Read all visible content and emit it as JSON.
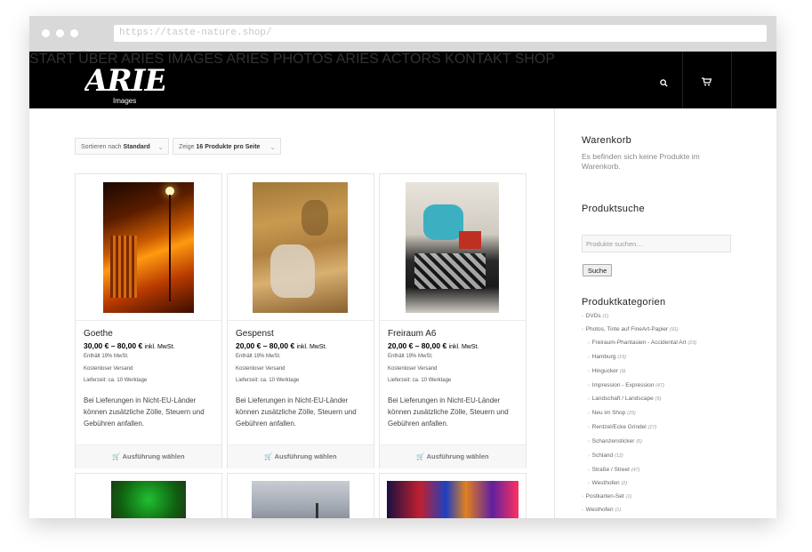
{
  "browser": {
    "url": "https://taste-nature.shop/"
  },
  "header": {
    "logo_text": "ARIES",
    "logo_sub": "Images",
    "nav": [
      "START",
      "ÜBER ARIES IMAGES",
      "ARIES PHOTOS",
      "ARIES ACTORS",
      "KONTAKT",
      "SHOP"
    ]
  },
  "shop": {
    "sort_prefix": "Sortieren nach",
    "sort_value": "Standard",
    "perpage_prefix": "Zeige",
    "perpage_value": "16 Produkte pro Seite",
    "products": [
      {
        "title": "Goethe",
        "price": "30,00 € – 80,00 €",
        "tax_suffix": "inkl. MwSt.",
        "vat": "Enthält 19% MwSt.",
        "shipping": "Kostenloser Versand",
        "delivery": "Lieferzeit: ca. 10 Werktage",
        "desc": "Bei Lieferungen in Nicht-EU-Länder können zusätzliche Zölle, Steuern und Gebühren anfallen.",
        "button": "Ausführung wählen"
      },
      {
        "title": "Gespenst",
        "price": "20,00 € – 80,00 €",
        "tax_suffix": "inkl. MwSt.",
        "vat": "Enthält 19% MwSt.",
        "shipping": "Kostenloser Versand",
        "delivery": "Lieferzeit: ca. 10 Werktage",
        "desc": "Bei Lieferungen in Nicht-EU-Länder können zusätzliche Zölle, Steuern und Gebühren anfallen.",
        "button": "Ausführung wählen"
      },
      {
        "title": "Freiraum A6",
        "price": "20,00 € – 80,00 €",
        "tax_suffix": "inkl. MwSt.",
        "vat": "Enthält 19% MwSt.",
        "shipping": "Kostenloser Versand",
        "delivery": "Lieferzeit: ca. 10 Werktage",
        "desc": "Bei Lieferungen in Nicht-EU-Länder können zusätzliche Zölle, Steuern und Gebühren anfallen.",
        "button": "Ausführung wählen"
      }
    ]
  },
  "sidebar": {
    "cart_title": "Warenkorb",
    "cart_empty": "Es befinden sich keine Produkte im Warenkorb.",
    "search_title": "Produktsuche",
    "search_placeholder": "Produkte suchen…",
    "search_button": "Suche",
    "categories_title": "Produktkategorien",
    "categories": [
      {
        "name": "DVDs",
        "count": "(1)",
        "level": 0
      },
      {
        "name": "Photos, Tinte auf FineArt-Papier",
        "count": "(91)",
        "level": 0
      },
      {
        "name": "Freiraum-Phantasien - Accidental Art",
        "count": "(23)",
        "level": 1
      },
      {
        "name": "Hamburg",
        "count": "(15)",
        "level": 1
      },
      {
        "name": "Hingucker",
        "count": "(9)",
        "level": 1
      },
      {
        "name": "Impression - Expression",
        "count": "(47)",
        "level": 1
      },
      {
        "name": "Landschaft / Landscape",
        "count": "(9)",
        "level": 1
      },
      {
        "name": "Neu im Shop",
        "count": "(25)",
        "level": 1
      },
      {
        "name": "Rentzel/Ecke Grindel",
        "count": "(27)",
        "level": 1
      },
      {
        "name": "Schanzensticker",
        "count": "(6)",
        "level": 1
      },
      {
        "name": "Schland",
        "count": "(12)",
        "level": 1
      },
      {
        "name": "Straße / Street",
        "count": "(47)",
        "level": 1
      },
      {
        "name": "Westhofen",
        "count": "(2)",
        "level": 1
      },
      {
        "name": "Postkarten-Set",
        "count": "(1)",
        "level": 0
      },
      {
        "name": "Westhofen",
        "count": "(1)",
        "level": 0
      }
    ]
  },
  "icons": {
    "search": "search-icon",
    "cart": "cart-icon"
  }
}
